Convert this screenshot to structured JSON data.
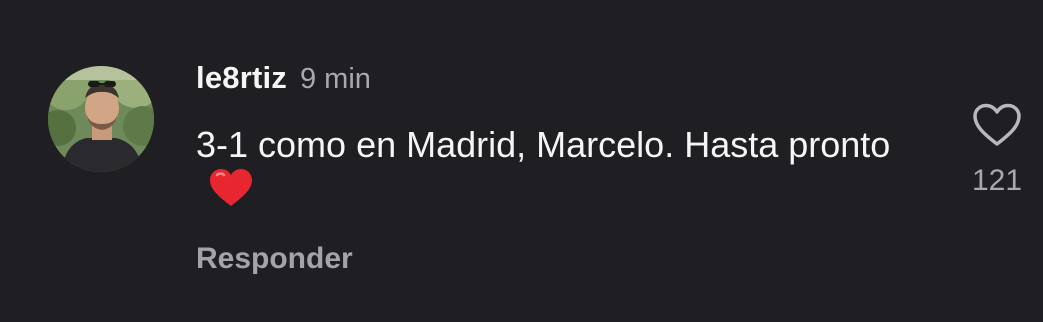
{
  "comment": {
    "username": "le8rtiz",
    "time": "9 min",
    "text": "3-1 como en Madrid, Marcelo. Hasta pronto",
    "emoji": "red-heart-emoji",
    "reply_label": "Responder",
    "like_count": "121",
    "avatar": "profile-photo"
  },
  "colors": {
    "background": "#1f1f23",
    "text": "#f5f5f5",
    "muted": "#a8a8ad",
    "emoji_red": "#e8262f"
  }
}
